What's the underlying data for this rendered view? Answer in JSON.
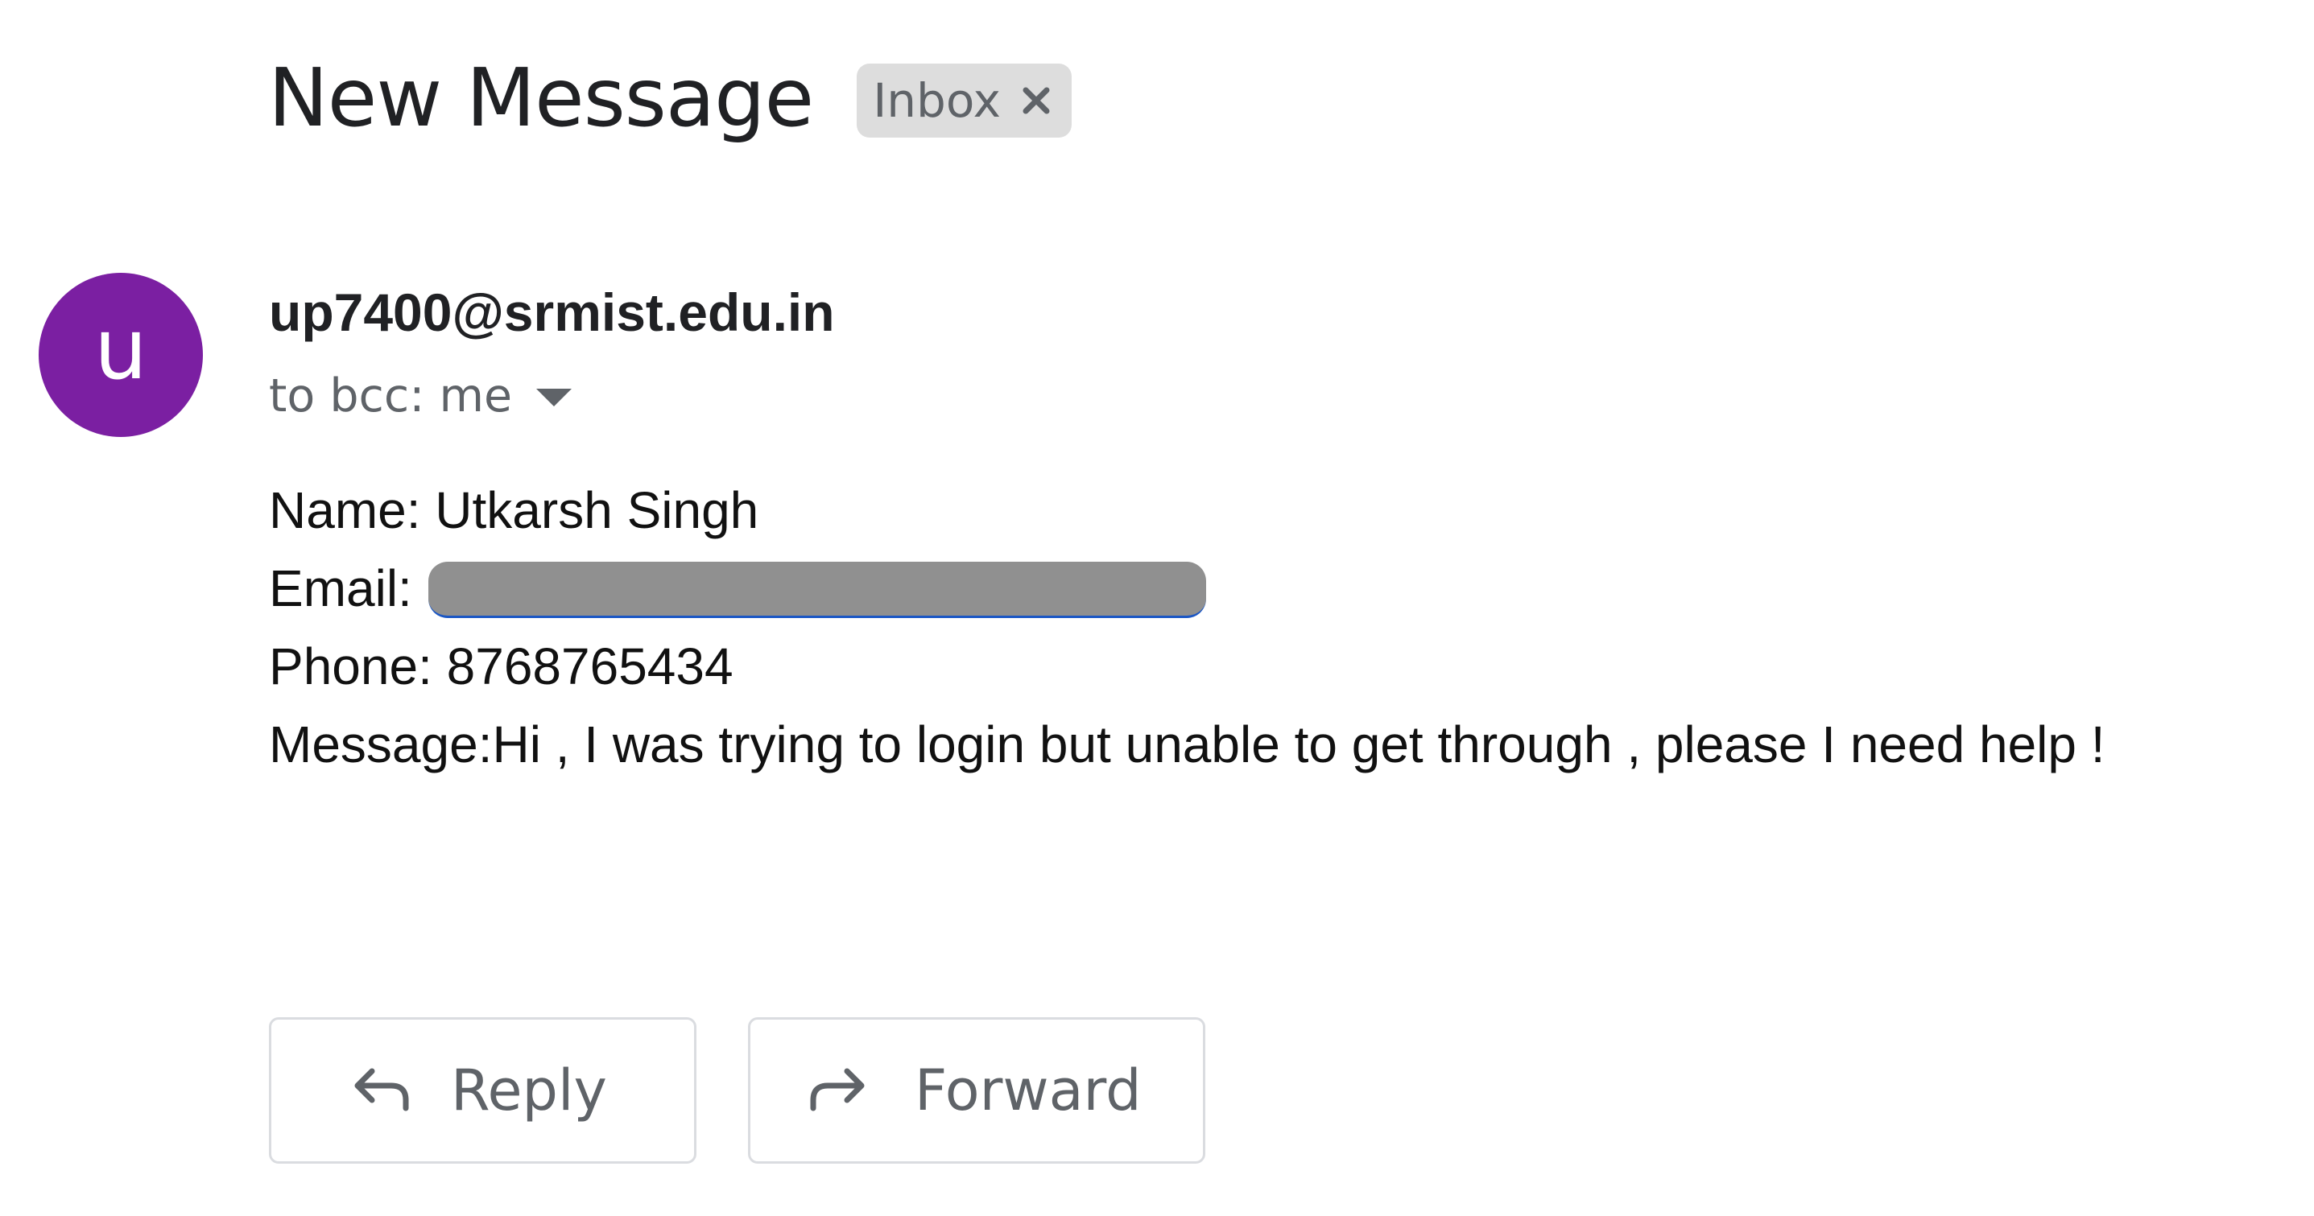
{
  "message": {
    "subject": "New Message",
    "label_chip": "Inbox",
    "sender": {
      "avatar_letter": "u",
      "avatar_color": "#7b1fa2",
      "address": "up7400@srmist.edu.in"
    },
    "recipients_text": "to bcc: me",
    "body": {
      "name_line": "Name: Utkarsh Singh",
      "email_label": "Email:",
      "phone_line": "Phone: 8768765434",
      "message_line": "Message:Hi , I was trying to login but unable to get through , please I need help !"
    }
  },
  "actions": {
    "reply_label": "Reply",
    "forward_label": "Forward"
  },
  "icons": {
    "chip_close": "close-icon",
    "details_toggle": "chevron-down-icon",
    "reply": "reply-icon",
    "forward": "forward-icon"
  }
}
